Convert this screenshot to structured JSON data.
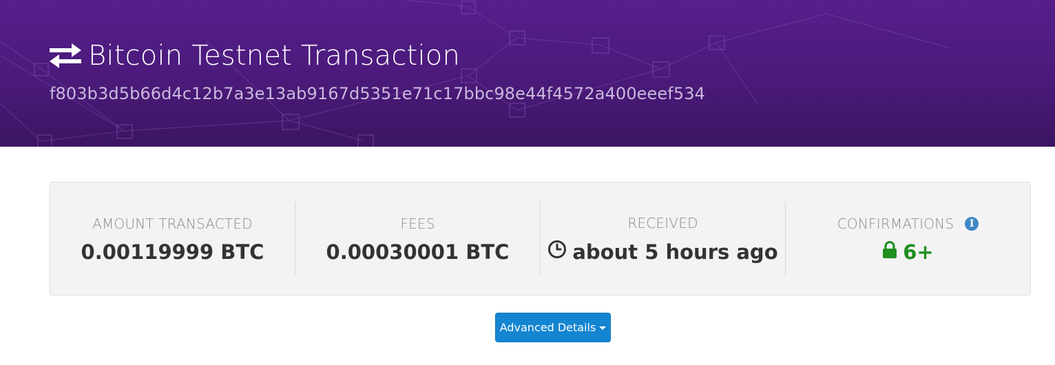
{
  "header": {
    "title": "Bitcoin Testnet Transaction",
    "tx_hash": "f803b3d5b66d4c12b7a3e13ab9167d5351e71c17bbc98e44f4572a400eeef534",
    "icon": "exchange-arrows-icon",
    "background_color": "#561f8c"
  },
  "stats": {
    "amount": {
      "label": "AMOUNT TRANSACTED",
      "value": "0.00119999 BTC"
    },
    "fees": {
      "label": "FEES",
      "value": "0.00030001 BTC"
    },
    "received": {
      "label": "RECEIVED",
      "value": "about 5 hours ago",
      "icon": "clock-icon"
    },
    "confirmations": {
      "label": "CONFIRMATIONS",
      "value": "6+",
      "icon": "lock-icon",
      "info_icon": "info-icon",
      "info_glyph": "i",
      "color": "#1f8f1f"
    }
  },
  "advanced_details": {
    "label": "Advanced Details",
    "color": "#1485d1"
  }
}
